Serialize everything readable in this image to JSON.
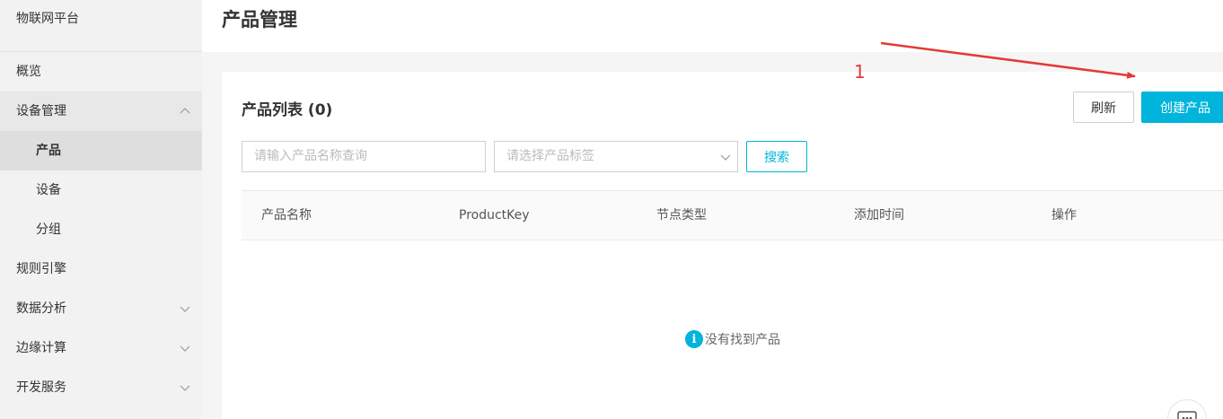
{
  "sidebar": {
    "brand": "物联网平台",
    "items": [
      {
        "label": "概览"
      },
      {
        "label": "设备管理"
      },
      {
        "label": "产品"
      },
      {
        "label": "设备"
      },
      {
        "label": "分组"
      },
      {
        "label": "规则引擎"
      },
      {
        "label": "数据分析"
      },
      {
        "label": "边缘计算"
      },
      {
        "label": "开发服务"
      }
    ]
  },
  "header": {
    "title": "产品管理"
  },
  "panel": {
    "title": "产品列表 (0)",
    "refresh_label": "刷新",
    "create_label": "创建产品",
    "search_placeholder": "请输入产品名称查询",
    "tag_placeholder": "请选择产品标签",
    "search_label": "搜索",
    "columns": [
      "产品名称",
      "ProductKey",
      "节点类型",
      "添加时间",
      "操作"
    ],
    "empty_text": "没有找到产品"
  },
  "annotation": {
    "number": "1",
    "color": "#e53935"
  },
  "colors": {
    "accent": "#00b4dc"
  }
}
